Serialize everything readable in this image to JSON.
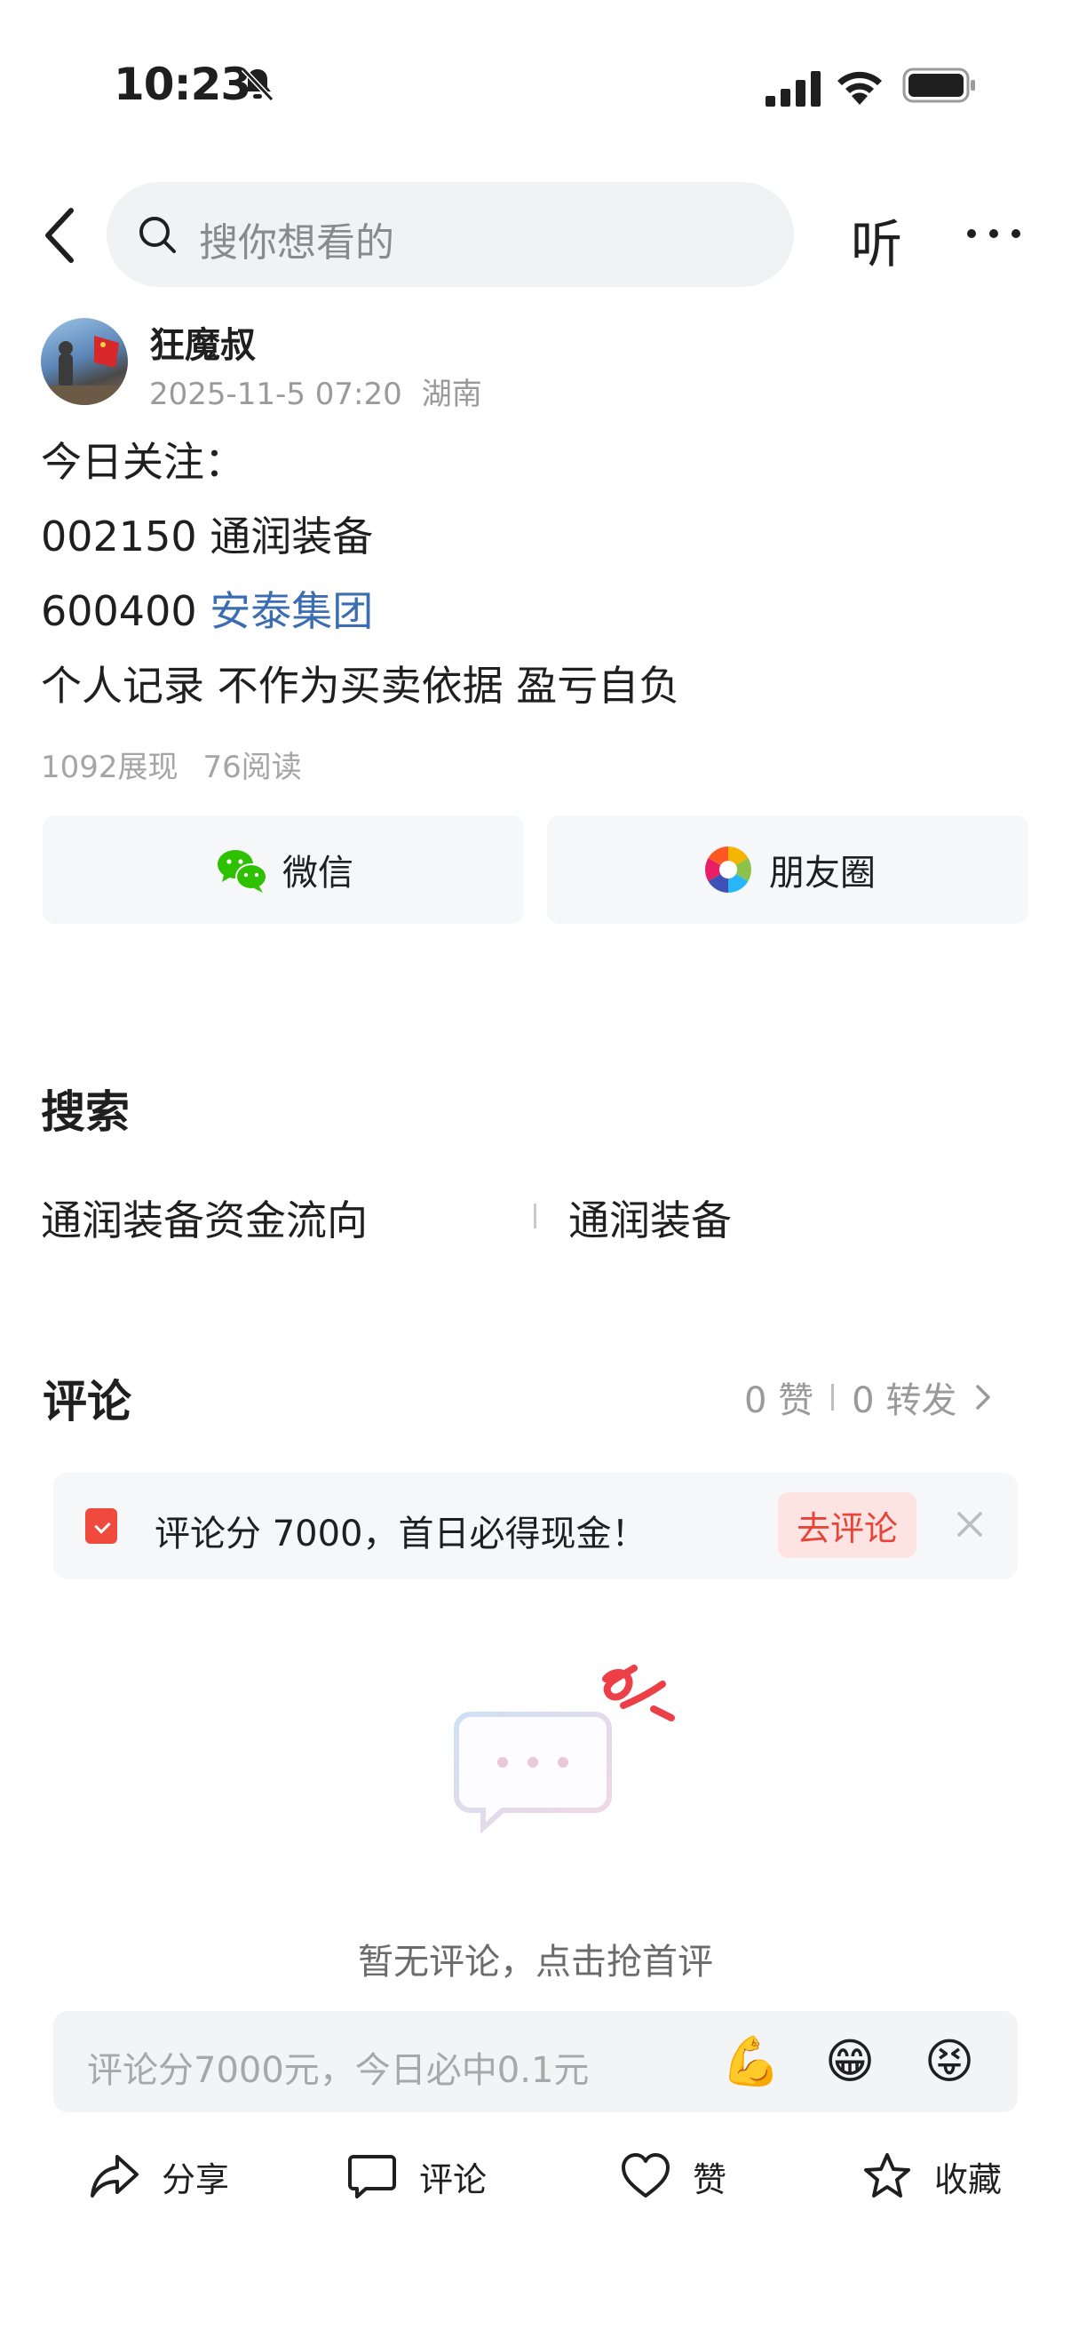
{
  "status_bar": {
    "time": "10:23"
  },
  "nav": {
    "search_placeholder": "搜你想看的",
    "listen_label": "听"
  },
  "post": {
    "author": "狂魔叔",
    "date": "2025-11-5 07:20",
    "location": "湖南",
    "lines": [
      "今日关注：",
      "002150 通润装备",
      "个人记录 不作为买卖依据 盈亏自负"
    ],
    "line3_prefix": "600400 ",
    "line3_link": "安泰集团",
    "views": "1092展现",
    "reads": "76阅读"
  },
  "share": {
    "wechat": "微信",
    "moments": "朋友圈"
  },
  "search_section": {
    "title": "搜索",
    "items": [
      "通润装备资金流向",
      "通润装备"
    ]
  },
  "comments": {
    "title": "评论",
    "likes": "0 赞",
    "forwards": "0 转发",
    "banner_text": "评论分 7000，首日必得现金！",
    "banner_button": "去评论",
    "empty_text": "暂无评论，点击抢首评",
    "input_placeholder": "评论分7000元，今日必中0.1元",
    "emojis": [
      "💪",
      "😁",
      "😝"
    ]
  },
  "bottom_bar": {
    "share": "分享",
    "comment": "评论",
    "like": "赞",
    "favorite": "收藏"
  },
  "colors": {
    "link": "#3b6db3",
    "accent_red": "#e8443a",
    "wechat_green": "#2dc100"
  }
}
